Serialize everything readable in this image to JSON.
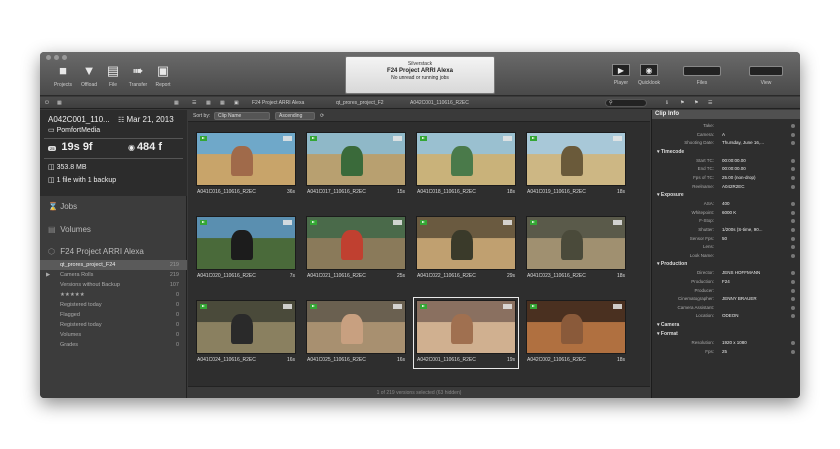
{
  "window": {
    "lcd_app": "Silverstack",
    "lcd_project": "F24 Project ARRI Alexa",
    "lcd_status": "No unread or running jobs"
  },
  "toolbar": {
    "projects": "Projects",
    "offload": "Offload",
    "file": "File",
    "transfer": "Transfer",
    "report": "Report",
    "player": "Player",
    "quicklook": "Quicklook",
    "files": "Files",
    "view": "View"
  },
  "breadcrumb": {
    "project": "F24 Project ARRI Alexa",
    "folder": "qt_prores_project_F2",
    "clip": "A042C001_110616_R2EC"
  },
  "clip_summary": {
    "name": "A042C001_110...",
    "date": "Mar 21, 2013",
    "volume": "PomfortMedia",
    "fps_badge": "25",
    "duration": "19s 9f",
    "frames": "484 f",
    "size": "353.8 MB",
    "backup": "1 file with 1 backup"
  },
  "sidebar": {
    "jobs": "Jobs",
    "volumes": "Volumes",
    "project": "F24 Project ARRI Alexa",
    "tree": [
      {
        "label": "qt_prores_project_F24",
        "count": "219"
      },
      {
        "label": "Camera Rolls",
        "count": "219"
      },
      {
        "label": "Versions without Backup",
        "count": "107"
      },
      {
        "label": "★★★★★",
        "count": "0"
      },
      {
        "label": "Registered today",
        "count": "0"
      },
      {
        "label": "Flagged",
        "count": "0"
      },
      {
        "label": "Registered today",
        "count": "0"
      },
      {
        "label": "Volumes",
        "count": "0"
      },
      {
        "label": "Grades",
        "count": "0"
      }
    ]
  },
  "sortbar": {
    "label": "Sort by:",
    "field": "Clip Name",
    "order": "Ascending"
  },
  "clips": [
    {
      "name": "A041C016_110616_R2EC",
      "dur": "36s"
    },
    {
      "name": "A041C017_110616_R2EC",
      "dur": "15s"
    },
    {
      "name": "A041C018_110616_R2EC",
      "dur": "18s"
    },
    {
      "name": "A041C019_110616_R2EC",
      "dur": "18s"
    },
    {
      "name": "A041C020_110616_R2EC",
      "dur": "7s"
    },
    {
      "name": "A041C021_110616_R2EC",
      "dur": "25s"
    },
    {
      "name": "A041C022_110616_R2EC",
      "dur": "29s"
    },
    {
      "name": "A041C023_110616_R2EC",
      "dur": "18s"
    },
    {
      "name": "A041C024_110616_R2EC",
      "dur": "16s"
    },
    {
      "name": "A041C025_110616_R2EC",
      "dur": "16s"
    },
    {
      "name": "A042C001_110616_R2EC",
      "dur": "19s"
    },
    {
      "name": "A042C002_110616_R2EC",
      "dur": "18s"
    }
  ],
  "statusbar": "1 of 219 versions selected (63 hidden)",
  "inspector": {
    "title": "Clip Info",
    "rows_top": [
      {
        "k": "Take:",
        "v": ""
      },
      {
        "k": "Camera:",
        "v": "A"
      },
      {
        "k": "Shooting Date:",
        "v": "Thursday, June 16,..."
      }
    ],
    "timecode_title": "Timecode",
    "timecode": [
      {
        "k": "Start TC:",
        "v": "00:00:00.00"
      },
      {
        "k": "End TC:",
        "v": "00:00:00.00"
      },
      {
        "k": "Fps of TC:",
        "v": "25.00 (non-drop)"
      },
      {
        "k": "Reelname:",
        "v": "A042R2EC"
      }
    ],
    "exposure_title": "Exposure",
    "exposure": [
      {
        "k": "ASA:",
        "v": "400"
      },
      {
        "k": "Whitepoint:",
        "v": "6000 K"
      },
      {
        "k": "F-Stop:",
        "v": ""
      },
      {
        "k": "Shutter:",
        "v": "1/200s (S-time, 90..."
      },
      {
        "k": "Sensor Fps:",
        "v": "50"
      },
      {
        "k": "Lens:",
        "v": ""
      },
      {
        "k": "Look Name:",
        "v": ""
      }
    ],
    "production_title": "Production",
    "production": [
      {
        "k": "Director:",
        "v": "JENS HOFFMANN"
      },
      {
        "k": "Production:",
        "v": "F24"
      },
      {
        "k": "Producer:",
        "v": ""
      },
      {
        "k": "Cinematographer:",
        "v": "JENNY BRAUER"
      },
      {
        "k": "Camera Assistant:",
        "v": ""
      },
      {
        "k": "Location:",
        "v": "ODEON"
      }
    ],
    "camera_title": "Camera",
    "format_title": "Format",
    "format": [
      {
        "k": "Resolution:",
        "v": "1920 x 1080"
      },
      {
        "k": "Fps:",
        "v": "25"
      }
    ]
  }
}
